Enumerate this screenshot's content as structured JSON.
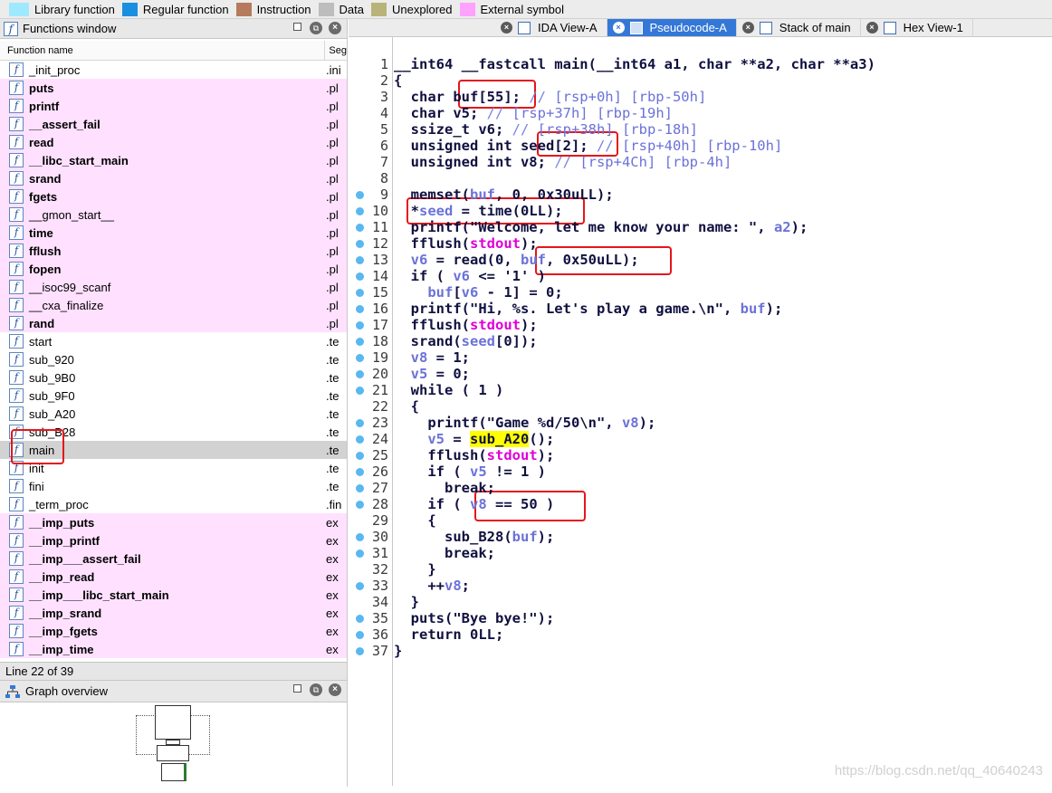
{
  "legend": [
    {
      "label": "Library function",
      "color": "#9ee9ff"
    },
    {
      "label": "Regular function",
      "color": "#1a8fe0"
    },
    {
      "label": "Instruction",
      "color": "#b57b5c"
    },
    {
      "label": "Data",
      "color": "#bdbdbd"
    },
    {
      "label": "Unexplored",
      "color": "#b9b37a"
    },
    {
      "label": "External symbol",
      "color": "#ffa2ff"
    }
  ],
  "functions_window": {
    "title": "Functions window",
    "col_name": "Function name",
    "col_segment": "Seg",
    "rows": [
      {
        "name": "_init_proc",
        "seg": ".ini",
        "pink": false,
        "bold": false
      },
      {
        "name": "puts",
        "seg": ".pl",
        "pink": true,
        "bold": true
      },
      {
        "name": "printf",
        "seg": ".pl",
        "pink": true,
        "bold": true
      },
      {
        "name": "__assert_fail",
        "seg": ".pl",
        "pink": true,
        "bold": true
      },
      {
        "name": "read",
        "seg": ".pl",
        "pink": true,
        "bold": true
      },
      {
        "name": "__libc_start_main",
        "seg": ".pl",
        "pink": true,
        "bold": true
      },
      {
        "name": "srand",
        "seg": ".pl",
        "pink": true,
        "bold": true
      },
      {
        "name": "fgets",
        "seg": ".pl",
        "pink": true,
        "bold": true
      },
      {
        "name": "__gmon_start__",
        "seg": ".pl",
        "pink": true,
        "bold": false
      },
      {
        "name": "time",
        "seg": ".pl",
        "pink": true,
        "bold": true
      },
      {
        "name": "fflush",
        "seg": ".pl",
        "pink": true,
        "bold": true
      },
      {
        "name": "fopen",
        "seg": ".pl",
        "pink": true,
        "bold": true
      },
      {
        "name": "__isoc99_scanf",
        "seg": ".pl",
        "pink": true,
        "bold": false
      },
      {
        "name": "__cxa_finalize",
        "seg": ".pl",
        "pink": true,
        "bold": false
      },
      {
        "name": "rand",
        "seg": ".pl",
        "pink": true,
        "bold": true
      },
      {
        "name": "start",
        "seg": ".te",
        "pink": false,
        "bold": false
      },
      {
        "name": "sub_920",
        "seg": ".te",
        "pink": false,
        "bold": false
      },
      {
        "name": "sub_9B0",
        "seg": ".te",
        "pink": false,
        "bold": false
      },
      {
        "name": "sub_9F0",
        "seg": ".te",
        "pink": false,
        "bold": false
      },
      {
        "name": "sub_A20",
        "seg": ".te",
        "pink": false,
        "bold": false
      },
      {
        "name": "sub_B28",
        "seg": ".te",
        "pink": false,
        "bold": false
      },
      {
        "name": "main",
        "seg": ".te",
        "pink": false,
        "bold": false,
        "selected": true
      },
      {
        "name": "init",
        "seg": ".te",
        "pink": false,
        "bold": false
      },
      {
        "name": "fini",
        "seg": ".te",
        "pink": false,
        "bold": false
      },
      {
        "name": "_term_proc",
        "seg": ".fin",
        "pink": false,
        "bold": false
      },
      {
        "name": "__imp_puts",
        "seg": "ex",
        "pink": true,
        "bold": true
      },
      {
        "name": "__imp_printf",
        "seg": "ex",
        "pink": true,
        "bold": true
      },
      {
        "name": "__imp___assert_fail",
        "seg": "ex",
        "pink": true,
        "bold": true
      },
      {
        "name": "__imp_read",
        "seg": "ex",
        "pink": true,
        "bold": true
      },
      {
        "name": "__imp___libc_start_main",
        "seg": "ex",
        "pink": true,
        "bold": true
      },
      {
        "name": "__imp_srand",
        "seg": "ex",
        "pink": true,
        "bold": true
      },
      {
        "name": "__imp_fgets",
        "seg": "ex",
        "pink": true,
        "bold": true
      },
      {
        "name": "__imp_time",
        "seg": "ex",
        "pink": true,
        "bold": true
      }
    ],
    "status": "Line 22 of 39"
  },
  "graph_overview": {
    "title": "Graph overview"
  },
  "tabs": [
    {
      "label": "IDA View-A",
      "active": false
    },
    {
      "label": "Pseudocode-A",
      "active": true
    },
    {
      "label": "Stack of main",
      "active": false
    },
    {
      "label": "Hex View-1",
      "active": false
    }
  ],
  "code": [
    {
      "n": "1",
      "dot": false,
      "html": "__int64 __fastcall main(__int64 a1, char **a2, char **a3)"
    },
    {
      "n": "2",
      "dot": false,
      "html": "{"
    },
    {
      "n": "3",
      "dot": false,
      "html": "  char buf[55]; <c>// [rsp+0h] [rbp-50h]</c>"
    },
    {
      "n": "4",
      "dot": false,
      "html": "  char v5; <c>// [rsp+37h] [rbp-19h]</c>"
    },
    {
      "n": "5",
      "dot": false,
      "html": "  ssize_t v6; <c>// [rsp+38h] [rbp-18h]</c>"
    },
    {
      "n": "6",
      "dot": false,
      "html": "  unsigned int seed[2]; <c>// [rsp+40h] [rbp-10h]</c>"
    },
    {
      "n": "7",
      "dot": false,
      "html": "  unsigned int v8; <c>// [rsp+4Ch] [rbp-4h]</c>"
    },
    {
      "n": "8",
      "dot": false,
      "html": ""
    },
    {
      "n": "9",
      "dot": true,
      "html": "  memset(<v>buf</v>, 0, 0x30uLL);"
    },
    {
      "n": "10",
      "dot": true,
      "html": "  *<v>seed</v> = time(0LL);"
    },
    {
      "n": "11",
      "dot": true,
      "html": "  printf(\"Welcome, let me know your name: \", <v>a2</v>);"
    },
    {
      "n": "12",
      "dot": true,
      "html": "  fflush(<m>stdout</m>);"
    },
    {
      "n": "13",
      "dot": true,
      "html": "  <v>v6</v> = read(0, <v>buf</v>, 0x50uLL);"
    },
    {
      "n": "14",
      "dot": true,
      "html": "  if ( <v>v6</v> <= '1' )"
    },
    {
      "n": "15",
      "dot": true,
      "html": "    <v>buf</v>[<v>v6</v> - 1] = 0;"
    },
    {
      "n": "16",
      "dot": true,
      "html": "  printf(\"Hi, %s. Let's play a game.\\n\", <v>buf</v>);"
    },
    {
      "n": "17",
      "dot": true,
      "html": "  fflush(<m>stdout</m>);"
    },
    {
      "n": "18",
      "dot": true,
      "html": "  srand(<v>seed</v>[0]);"
    },
    {
      "n": "19",
      "dot": true,
      "html": "  <v>v8</v> = 1;"
    },
    {
      "n": "20",
      "dot": true,
      "html": "  <v>v5</v> = 0;"
    },
    {
      "n": "21",
      "dot": true,
      "html": "  while ( 1 )"
    },
    {
      "n": "22",
      "dot": false,
      "html": "  {"
    },
    {
      "n": "23",
      "dot": true,
      "html": "    printf(\"Game %d/50\\n\", <v>v8</v>);"
    },
    {
      "n": "24",
      "dot": true,
      "html": "    <v>v5</v> = <y>sub_A20</y>();"
    },
    {
      "n": "25",
      "dot": true,
      "html": "    fflush(<m>stdout</m>);"
    },
    {
      "n": "26",
      "dot": true,
      "html": "    if ( <v>v5</v> != 1 )"
    },
    {
      "n": "27",
      "dot": true,
      "html": "      break;"
    },
    {
      "n": "28",
      "dot": true,
      "html": "    if ( <v>v8</v> == 50 )"
    },
    {
      "n": "29",
      "dot": false,
      "html": "    {"
    },
    {
      "n": "30",
      "dot": true,
      "html": "      sub_B28(<v>buf</v>);"
    },
    {
      "n": "31",
      "dot": true,
      "html": "      break;"
    },
    {
      "n": "32",
      "dot": false,
      "html": "    }"
    },
    {
      "n": "33",
      "dot": true,
      "html": "    ++<v>v8</v>;"
    },
    {
      "n": "34",
      "dot": false,
      "html": "  }"
    },
    {
      "n": "35",
      "dot": true,
      "html": "  puts(\"Bye bye!\");"
    },
    {
      "n": "36",
      "dot": true,
      "html": "  return 0LL;"
    },
    {
      "n": "37",
      "dot": true,
      "html": "}"
    }
  ],
  "watermark": "https://blog.csdn.net/qq_40640243"
}
